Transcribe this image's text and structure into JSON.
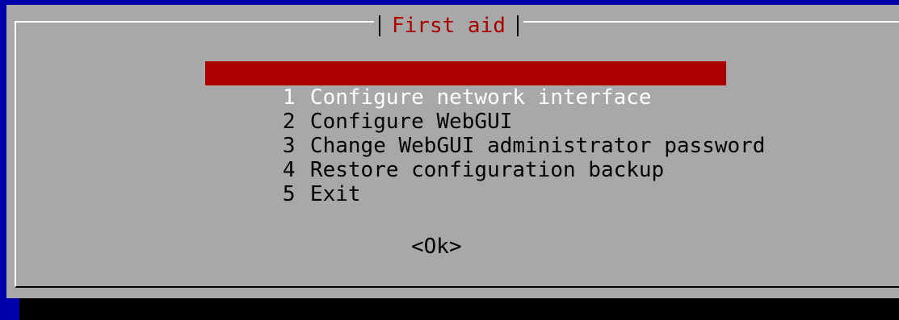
{
  "dialog": {
    "title": "First aid",
    "menu": [
      {
        "num": "1",
        "label": "Configure network interface",
        "selected": true
      },
      {
        "num": "2",
        "label": "Configure WebGUI",
        "selected": false
      },
      {
        "num": "3",
        "label": "Change WebGUI administrator password",
        "selected": false
      },
      {
        "num": "4",
        "label": "Restore configuration backup",
        "selected": false
      },
      {
        "num": "5",
        "label": "Exit",
        "selected": false
      }
    ],
    "ok_label": "<Ok>"
  },
  "colors": {
    "background": "#0000aa",
    "dialog": "#a8a8a8",
    "highlight": "#aa0000",
    "title_text": "#aa0000"
  }
}
